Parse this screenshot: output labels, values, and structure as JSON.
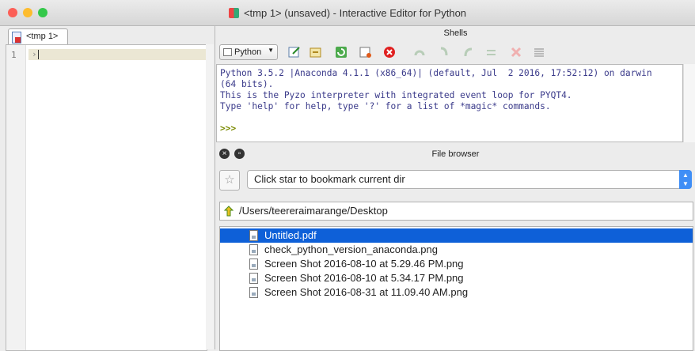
{
  "window": {
    "title": "<tmp 1> (unsaved) - Interactive Editor for Python"
  },
  "editor": {
    "tab_label": "<tmp 1>",
    "line_numbers": [
      "1"
    ],
    "current_line_marker": "›"
  },
  "shells": {
    "header": "Shells",
    "interpreter_label": "Python",
    "output_lines": [
      "Python 3.5.2 |Anaconda 4.1.1 (x86_64)| (default, Jul  2 2016, 17:52:12) on darwin",
      "(64 bits).",
      "This is the Pyzo interpreter with integrated event loop for PYQT4.",
      "Type 'help' for help, type '?' for a list of *magic* commands."
    ],
    "prompt": ">>>"
  },
  "file_browser": {
    "title": "File browser",
    "bookmark_placeholder": "Click star to bookmark current dir",
    "path": "/Users/teereraimarange/Desktop",
    "files": [
      {
        "name": "Untitled.pdf",
        "selected": true
      },
      {
        "name": "check_python_version_anaconda.png",
        "selected": false
      },
      {
        "name": "Screen Shot 2016-08-10 at 5.29.46 PM.png",
        "selected": false
      },
      {
        "name": "Screen Shot 2016-08-10 at 5.34.17 PM.png",
        "selected": false
      },
      {
        "name": "Screen Shot 2016-08-31 at 11.09.40 AM.png",
        "selected": false
      }
    ]
  },
  "colors": {
    "accent": "#0e60d8",
    "close": "#fc5f57",
    "minimize": "#fdbc2e",
    "zoom": "#34c84a"
  }
}
